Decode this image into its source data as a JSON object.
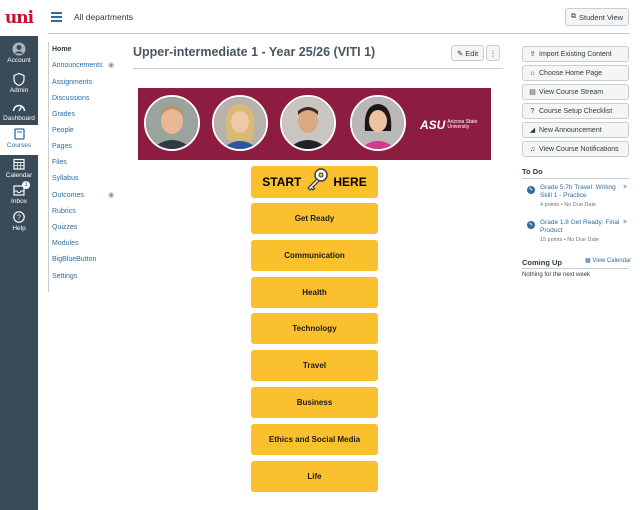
{
  "global_nav": {
    "logo_text": "uni",
    "items": [
      {
        "label": "Account"
      },
      {
        "label": "Admin"
      },
      {
        "label": "Dashboard"
      },
      {
        "label": "Courses"
      },
      {
        "label": "Calendar"
      },
      {
        "label": "Inbox",
        "badge": "1"
      },
      {
        "label": "Help"
      }
    ]
  },
  "header": {
    "breadcrumb": "All departments",
    "student_view": "Student View"
  },
  "course_nav": {
    "items": [
      "Home",
      "Announcements",
      "Assignments",
      "Discussions",
      "Grades",
      "People",
      "Pages",
      "Files",
      "Syllabus",
      "Outcomes",
      "Rubrics",
      "Quizzes",
      "Modules",
      "BigBlueButton",
      "Settings"
    ]
  },
  "main": {
    "title": "Upper-intermediate 1 - Year 25/26 (VITI 1)",
    "edit_label": "Edit",
    "more_label": "⋮",
    "banner": {
      "logo": "ASU",
      "logo_text": "Arizona State University"
    },
    "start_left": "START",
    "start_right": "HERE",
    "buttons": [
      "Get Ready",
      "Communication",
      "Health",
      "Technology",
      "Travel",
      "Business",
      "Ethics and Social Media",
      "Life"
    ]
  },
  "sidebar": {
    "actions": [
      {
        "label": "Import Existing Content",
        "icon": "import-icon"
      },
      {
        "label": "Choose Home Page",
        "icon": "home-icon"
      },
      {
        "label": "View Course Stream",
        "icon": "stream-icon"
      },
      {
        "label": "Course Setup Checklist",
        "icon": "help-icon"
      },
      {
        "label": "New Announcement",
        "icon": "announcement-icon"
      },
      {
        "label": "View Course Notifications",
        "icon": "bell-icon"
      }
    ],
    "todo_heading": "To Do",
    "todo": [
      {
        "title": "Grade 5.7b Travel: Writing Skill 1 - Practice",
        "meta": "4 points • No Due Date"
      },
      {
        "title": "Grade 1.8 Get Ready: Final Product",
        "meta": "15 points • No Due Date"
      }
    ],
    "coming_up_heading": "Coming Up",
    "view_calendar": "View Calendar",
    "nothing": "Nothing for the next week"
  },
  "colors": {
    "nav_bg": "#394b58",
    "link": "#2d6c9f",
    "banner": "#8c1d40",
    "button": "#fbc02d"
  }
}
